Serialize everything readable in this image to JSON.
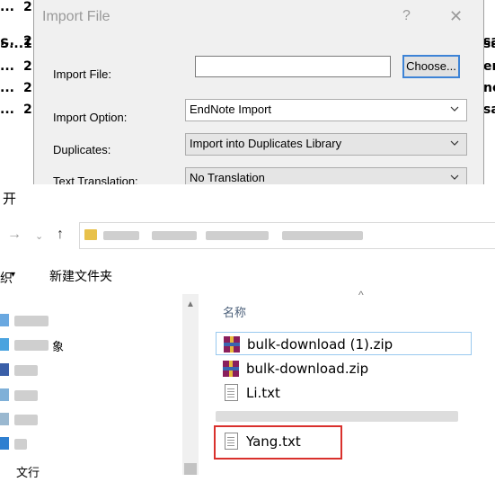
{
  "background_list": {
    "rows": [
      {
        "c1": "...",
        "c2": "2",
        "c3": ""
      },
      {
        "c1": "...",
        "c2": "2",
        "c3": "sa"
      },
      {
        "c1": "S...",
        "c2": "1",
        "c3": "sa"
      },
      {
        "c1": "...",
        "c2": "2",
        "c3": "en"
      },
      {
        "c1": "...",
        "c2": "2",
        "c3": "ne"
      },
      {
        "c1": "...",
        "c2": "2",
        "c3": "sa"
      }
    ]
  },
  "import_dialog": {
    "title": "Import File",
    "help_glyph": "?",
    "close_glyph": "✕",
    "import_file_label": "Import File:",
    "import_file_value": "",
    "choose_button": "Choose...",
    "import_option_label": "Import Option:",
    "import_option_value": "EndNote Import",
    "duplicates_label": "Duplicates:",
    "duplicates_value": "Import into Duplicates Library",
    "text_translation_label": "Text Translation:",
    "text_translation_value": "No Translation"
  },
  "open_dialog": {
    "title": "开",
    "organize_label": "织",
    "new_folder_button": "新建文件夹",
    "nav_items": [
      {
        "label": ""
      },
      {
        "label": "象"
      },
      {
        "label": ""
      },
      {
        "label": ""
      },
      {
        "label": ""
      },
      {
        "label": ""
      },
      {
        "label": "文行"
      }
    ],
    "column_name": "名称",
    "files": [
      {
        "name": "bulk-download (1).zip",
        "type": "zip",
        "selected": true
      },
      {
        "name": "bulk-download.zip",
        "type": "zip",
        "selected": false
      },
      {
        "name": "Li.txt",
        "type": "txt",
        "selected": false
      },
      {
        "name": "Yang.txt",
        "type": "txt",
        "selected": false
      }
    ]
  },
  "colors": {
    "dialog_bg": "#f0f0f0",
    "choose_border": "#3d83d6",
    "highlight_red": "#d9302c",
    "selection_border": "#99c9ef",
    "column_header": "#4c607a"
  }
}
